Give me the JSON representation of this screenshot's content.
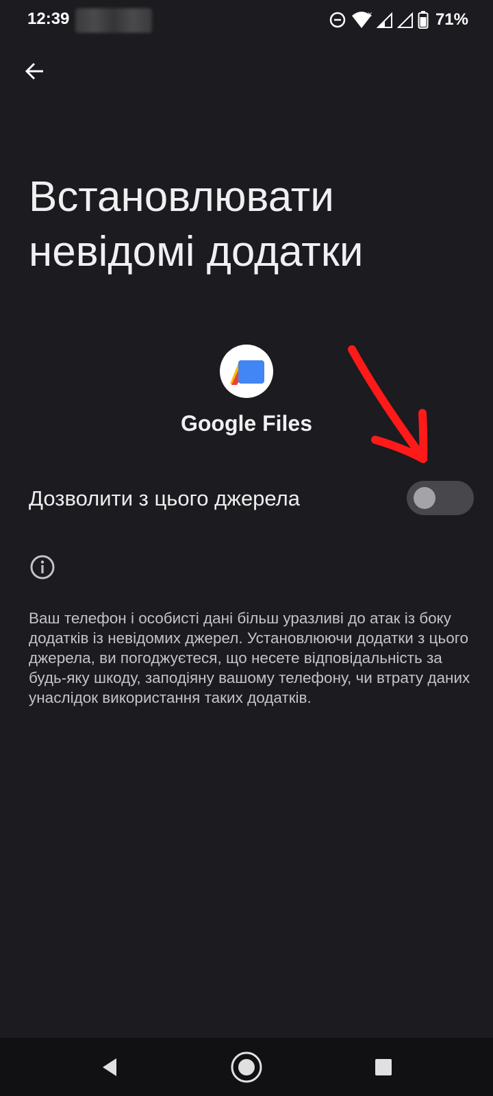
{
  "status_bar": {
    "time": "12:39",
    "battery": "71%",
    "icons": [
      "do-not-disturb-icon",
      "wifi-icon",
      "signal-icon",
      "signal-icon",
      "battery-icon"
    ]
  },
  "header": {
    "back_icon": "arrow-back-icon"
  },
  "page": {
    "title": "Встановлювати невідомі додатки"
  },
  "app": {
    "name": "Google Files",
    "icon": "files-app-icon"
  },
  "setting": {
    "label": "Дозволити з цього джерела",
    "enabled": false
  },
  "info": {
    "icon": "info-icon",
    "text": "Ваш телефон і особисті дані більш уразливі до атак із боку додатків із невідомих джерел. Установлюючи додатки з цього джерела, ви погоджуєтеся, що несете відповідальність за будь-яку шкоду, заподіяну вашому телефону, чи втрату даних унаслідок використання таких додатків."
  },
  "annotation": {
    "arrow_color": "#ff1a1a"
  },
  "nav": {
    "back_icon": "nav-back-icon",
    "home_icon": "nav-home-icon",
    "recents_icon": "nav-recents-icon"
  },
  "colors": {
    "background": "#1c1b1f",
    "toggle_track": "#48484c",
    "toggle_knob": "#a4a4a8"
  }
}
